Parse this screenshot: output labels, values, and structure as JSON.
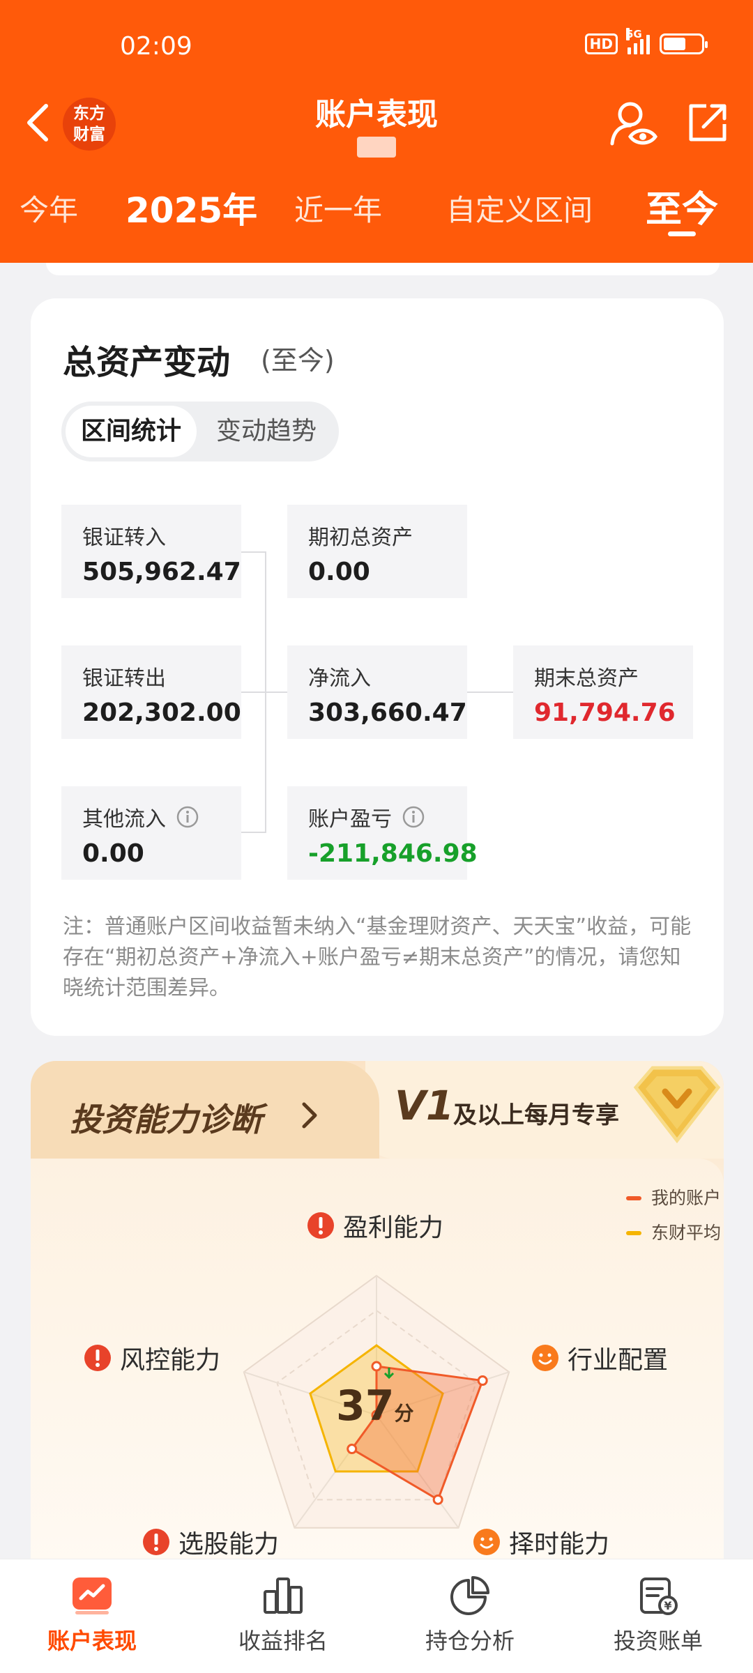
{
  "status_bar": {
    "time": "02:09",
    "hd": "HD",
    "network": "5G"
  },
  "header": {
    "brand": "东方\n财富",
    "title": "账户表现",
    "tabs": [
      "今年",
      "2025年",
      "近一年",
      "自定义区间",
      "至今"
    ],
    "active_tab": "至今"
  },
  "asset_card": {
    "title": "总资产变动",
    "subtitle": "(至今)",
    "segments": [
      "区间统计",
      "变动趋势"
    ],
    "active_segment": "区间统计",
    "stats": {
      "bank_in": {
        "label": "银证转入",
        "value": "505,962.47"
      },
      "begin_assets": {
        "label": "期初总资产",
        "value": "0.00"
      },
      "bank_out": {
        "label": "银证转出",
        "value": "202,302.00"
      },
      "net_inflow": {
        "label": "净流入",
        "value": "303,660.47"
      },
      "end_assets": {
        "label": "期末总资产",
        "value": "91,794.76"
      },
      "other_inflow": {
        "label": "其他流入",
        "value": "0.00"
      },
      "profit_loss": {
        "label": "账户盈亏",
        "value": "-211,846.98"
      }
    },
    "note": "注：普通账户区间收益暂未纳入“基金理财资产、天天宝”收益，可能存在“期初总资产+净流入+账户盈亏≠期末总资产”的情况，请您知晓统计范围差异。"
  },
  "diagnosis": {
    "title": "投资能力诊断",
    "vip_level": "V1",
    "vip_text": "及以上每月专享",
    "legend": [
      "我的账户",
      "东财平均"
    ],
    "legend_colors": [
      "#f05a28",
      "#f5b400"
    ],
    "axes": [
      "盈利能力",
      "行业配置",
      "择时能力",
      "选股能力",
      "风控能力"
    ],
    "score": "37",
    "score_unit": "分",
    "my_account_levels": [
      0.35,
      0.8,
      0.75,
      0.3,
      0.0
    ],
    "average_levels": [
      0.5,
      0.5,
      0.5,
      0.5,
      0.5
    ]
  },
  "bottom_nav": {
    "items": [
      "账户表现",
      "收益排名",
      "持仓分析",
      "投资账单"
    ],
    "active": "账户表现"
  }
}
